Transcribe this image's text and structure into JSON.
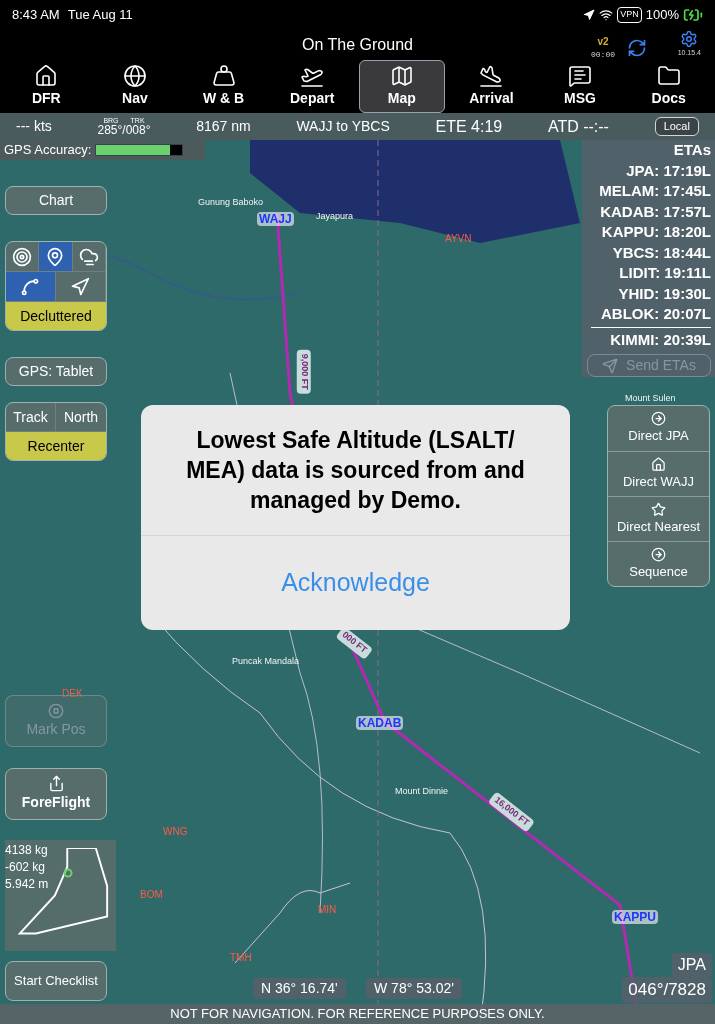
{
  "status_bar": {
    "time": "8:43 AM",
    "date": "Tue Aug 11",
    "vpn": "VPN",
    "battery": "100%"
  },
  "header": {
    "title": "On The Ground",
    "version": "v2",
    "timer": "00:00",
    "build": "10.15.4"
  },
  "tabs": [
    {
      "label": "DFR",
      "kind": "home",
      "selected": false
    },
    {
      "label": "Nav",
      "kind": "globe",
      "selected": false
    },
    {
      "label": "W & B",
      "kind": "weight",
      "selected": false
    },
    {
      "label": "Depart",
      "kind": "takeoff",
      "selected": false
    },
    {
      "label": "Map",
      "kind": "map",
      "selected": true
    },
    {
      "label": "Arrival",
      "kind": "landing",
      "selected": false
    },
    {
      "label": "MSG",
      "kind": "message",
      "selected": false
    },
    {
      "label": "Docs",
      "kind": "folder",
      "selected": false
    }
  ],
  "info_bar": {
    "speed": "--- kts",
    "brg_label": "BRG",
    "trk_label": "TRK",
    "bearing": "285°/008°",
    "distance": "8167 nm",
    "route": "WAJJ to YBCS",
    "ete": "ETE 4:19",
    "atd": "ATD --:--",
    "time_mode": "Local"
  },
  "gps_accuracy": {
    "label": "GPS Accuracy:",
    "level": 0.85
  },
  "left_panel": {
    "chart": "Chart",
    "layers": [
      {
        "kind": "rings",
        "selected": false
      },
      {
        "kind": "pin",
        "selected": true
      },
      {
        "kind": "cloud",
        "selected": false
      },
      {
        "kind": "route",
        "selected": true
      },
      {
        "kind": "arrow",
        "selected": false
      }
    ],
    "declutter": "Decluttered",
    "gps_source": "GPS: Tablet",
    "orientation": [
      {
        "label": "Track",
        "selected": false
      },
      {
        "label": "North",
        "selected": false
      }
    ],
    "recenter": "Recenter",
    "mark_pos": {
      "label": "Mark Pos",
      "disabled": true
    },
    "foreflight": "ForeFlight",
    "weight_box": [
      "4138 kg",
      "-602 kg",
      "5.942 m"
    ],
    "checklist": "Start Checklist"
  },
  "etas": {
    "title": "ETAs",
    "items": [
      "JPA: 17:19L",
      "MELAM: 17:45L",
      "KADAB: 17:57L",
      "KAPPU: 18:20L",
      "YBCS: 18:44L",
      "LIDIT: 19:11L",
      "YHID: 19:30L",
      "ABLOK: 20:07L"
    ],
    "final": "KIMMI: 20:39L",
    "send": {
      "label": "Send ETAs",
      "disabled": true
    }
  },
  "direct_menu": [
    {
      "label": "Direct JPA",
      "kind": "arrow"
    },
    {
      "label": "Direct WAJJ",
      "kind": "home"
    },
    {
      "label": "Direct Nearest",
      "kind": "star"
    },
    {
      "label": "Sequence",
      "kind": "arrow"
    }
  ],
  "map_labels": [
    {
      "text": "Gunung Baboko",
      "kind": "place"
    },
    {
      "text": "Jayapura",
      "kind": "place"
    },
    {
      "text": "WAJJ",
      "kind": "waypoint"
    },
    {
      "text": "AYVN",
      "kind": "fix"
    },
    {
      "text": "9,000 FT",
      "kind": "altitude"
    },
    {
      "text": "Mount Sulen",
      "kind": "place"
    },
    {
      "text": "Puncak Mandala",
      "kind": "place"
    },
    {
      "text": "000 FT",
      "kind": "altitude"
    },
    {
      "text": "KADAB",
      "kind": "waypoint"
    },
    {
      "text": "Mount Dinnie",
      "kind": "place"
    },
    {
      "text": "16,000 FT",
      "kind": "altitude"
    },
    {
      "text": "KAPPU",
      "kind": "waypoint"
    },
    {
      "text": "WNG",
      "kind": "fix"
    },
    {
      "text": "BOM",
      "kind": "fix"
    },
    {
      "text": "MIN",
      "kind": "fix"
    },
    {
      "text": "TMH",
      "kind": "fix"
    },
    {
      "text": "DEK",
      "kind": "fix"
    }
  ],
  "dialog": {
    "message": "Lowest Safe Altitude (LSALT/ MEA) data is sourced from and managed by Demo.",
    "button": "Acknowledge"
  },
  "position": {
    "lat": "N 36° 16.74'",
    "lon": "W 78° 53.02'"
  },
  "destination": {
    "name": "JPA",
    "bearing_distance": "046°/7828"
  },
  "footer": "NOT FOR NAVIGATION. FOR REFERENCE PURPOSES ONLY."
}
